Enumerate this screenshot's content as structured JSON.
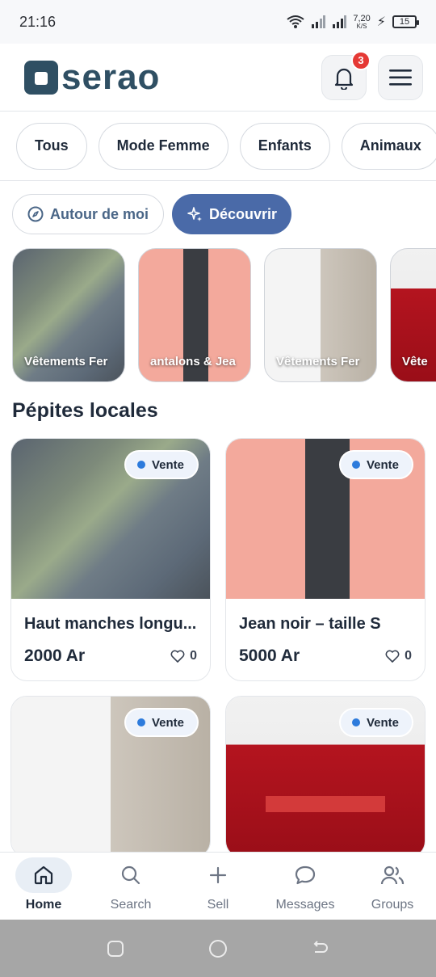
{
  "status_bar": {
    "time": "21:16",
    "speed_value": "7,20",
    "speed_unit": "K/S",
    "battery": "15"
  },
  "header": {
    "logo_text": "serao",
    "notification_count": "3"
  },
  "categories": [
    "Tous",
    "Mode Femme",
    "Enfants",
    "Animaux"
  ],
  "modes": {
    "nearby_label": "Autour de moi",
    "discover_label": "Découvrir"
  },
  "stories": [
    {
      "label": "Vêtements Fer"
    },
    {
      "label": "antalons & Jea"
    },
    {
      "label": "Vêtements Fer"
    },
    {
      "label": "Vête"
    }
  ],
  "section": {
    "title": "Pépites locales"
  },
  "listings": [
    {
      "badge": "Vente",
      "title": "Haut manches longu...",
      "price": "2000 Ar",
      "likes": "0"
    },
    {
      "badge": "Vente",
      "title": "Jean noir – taille S",
      "price": "5000 Ar",
      "likes": "0"
    },
    {
      "badge": "Vente",
      "title": "",
      "price": "",
      "likes": ""
    },
    {
      "badge": "Vente",
      "title": "",
      "price": "",
      "likes": ""
    }
  ],
  "nav": [
    {
      "label": "Home",
      "icon": "home-icon"
    },
    {
      "label": "Search",
      "icon": "search-icon"
    },
    {
      "label": "Sell",
      "icon": "plus-icon"
    },
    {
      "label": "Messages",
      "icon": "chat-icon"
    },
    {
      "label": "Groups",
      "icon": "users-icon"
    }
  ],
  "colors": {
    "brand": "#2f4f63",
    "accent": "#4a6aa8",
    "badge_dot": "#2d7bdc",
    "notif": "#e53935"
  }
}
